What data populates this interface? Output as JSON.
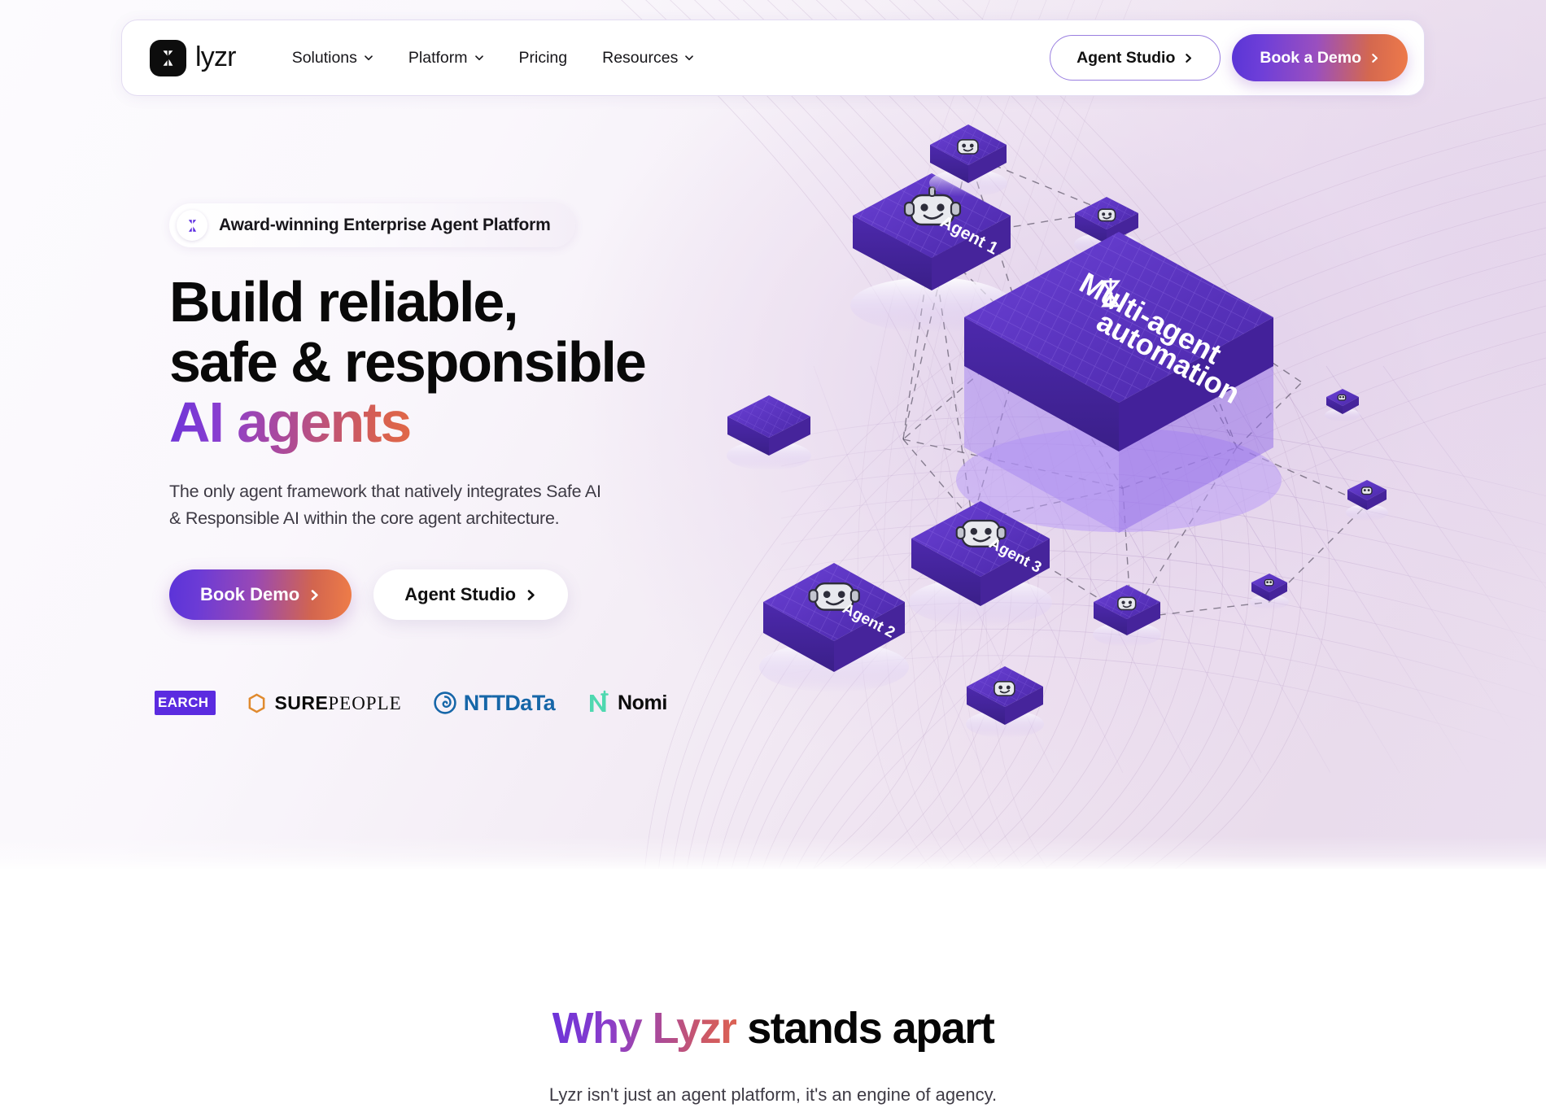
{
  "nav": {
    "brand": {
      "name": "lyzr",
      "mark_icon": "lyzr-logo-icon"
    },
    "links": [
      {
        "label": "Solutions",
        "has_dropdown": true
      },
      {
        "label": "Platform",
        "has_dropdown": true
      },
      {
        "label": "Pricing",
        "has_dropdown": false
      },
      {
        "label": "Resources",
        "has_dropdown": true
      }
    ],
    "agent_studio_label": "Agent Studio",
    "book_demo_label": "Book a Demo"
  },
  "hero": {
    "badge": {
      "label": "Award-winning Enterprise Agent Platform",
      "icon": "lyzr-logo-icon"
    },
    "headline_line1": "Build reliable,",
    "headline_line2": "safe & responsible",
    "headline_line3_gradient": "AI agents",
    "subtitle_line1": "The only agent framework that natively integrates Safe AI",
    "subtitle_line2": "& Responsible AI within the core agent architecture.",
    "cta_primary": "Book Demo",
    "cta_secondary": "Agent Studio",
    "logos": [
      {
        "name": "research",
        "text": "EARCH"
      },
      {
        "name": "surepeople",
        "bold": "SURE",
        "light": "PEOPLE"
      },
      {
        "name": "ntt-data",
        "text": "NTTDaTa"
      },
      {
        "name": "nomi",
        "text": "Nomi"
      }
    ]
  },
  "illustration": {
    "center_card": {
      "title_line1": "Multi-agent",
      "title_line2": "automation",
      "icon": "lyzr-logo-icon"
    },
    "agents": [
      {
        "label": "Agent 1"
      },
      {
        "label": "Agent 2"
      },
      {
        "label": "Agent 3"
      }
    ]
  },
  "why_section": {
    "title_gradient": "Why Lyzr",
    "title_rest": " stands apart",
    "subtitle": "Lyzr isn't just an agent platform, it's an engine of agency."
  },
  "colors": {
    "purple": "#5b2be0",
    "deep_purple": "#4b2bb5",
    "orange": "#ee7a4a",
    "accent_blue": "#1666a8",
    "nomi_green": "#4fd8b0"
  }
}
